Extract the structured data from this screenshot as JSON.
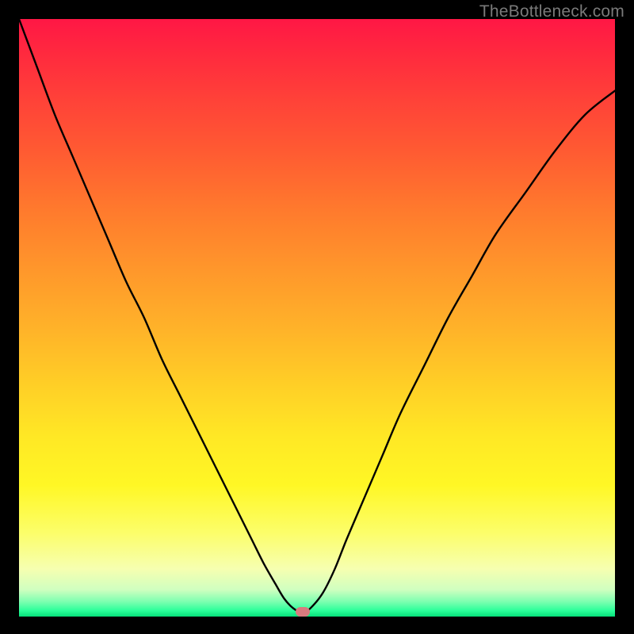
{
  "watermark": "TheBottleneck.com",
  "marker": {
    "x_frac": 0.476,
    "y_frac": 0.992
  },
  "chart_data": {
    "type": "line",
    "title": "",
    "xlabel": "",
    "ylabel": "",
    "xlim": [
      0,
      100
    ],
    "ylim": [
      0,
      100
    ],
    "x": [
      0,
      3,
      6,
      9,
      12,
      15,
      18,
      21,
      24,
      27,
      30,
      33,
      36,
      39,
      41,
      43,
      44.5,
      46,
      47.6,
      49,
      51,
      53,
      55,
      58,
      61,
      64,
      68,
      72,
      76,
      80,
      85,
      90,
      95,
      100
    ],
    "y": [
      100,
      92,
      84,
      77,
      70,
      63,
      56,
      50,
      43,
      37,
      31,
      25,
      19,
      13,
      9,
      5.5,
      3,
      1.4,
      0.6,
      1.5,
      4,
      8,
      13,
      20,
      27,
      34,
      42,
      50,
      57,
      64,
      71,
      78,
      84,
      88
    ],
    "series": [
      {
        "name": "bottleneck-curve",
        "color": "#000000"
      }
    ],
    "background_gradient": {
      "stops": [
        {
          "pos": 0.0,
          "color": "#ff1745"
        },
        {
          "pos": 0.5,
          "color": "#ffb329"
        },
        {
          "pos": 0.78,
          "color": "#fff725"
        },
        {
          "pos": 0.96,
          "color": "#d0ffc0"
        },
        {
          "pos": 1.0,
          "color": "#06e07a"
        }
      ]
    },
    "marker": {
      "x": 47.6,
      "y": 0.8,
      "color": "#d97a7e"
    }
  }
}
